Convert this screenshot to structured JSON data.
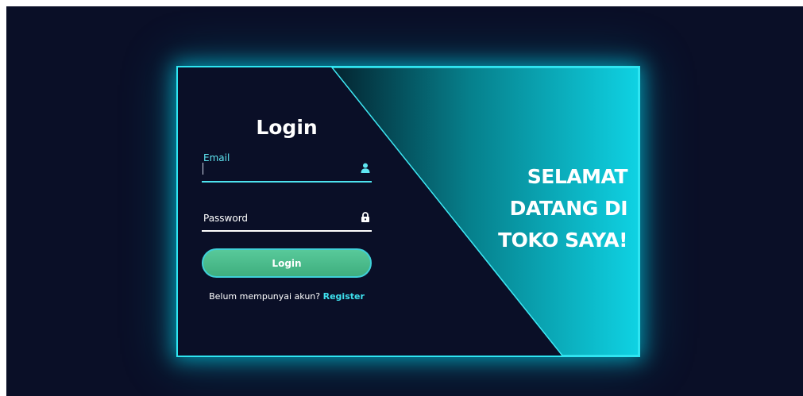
{
  "login": {
    "title": "Login",
    "email_label": "Email",
    "password_label": "Password",
    "button_label": "Login",
    "register_prompt": "Belum mempunyai akun?",
    "register_link": "Register",
    "email_icon": "user-icon",
    "password_icon": "lock-icon"
  },
  "welcome": {
    "text": "SELAMAT DATANG DI TOKO SAYA!"
  },
  "colors": {
    "background": "#0a0f27",
    "accent": "#2ee6f2",
    "button": "#4dbd8c",
    "link": "#3ee0ee"
  }
}
